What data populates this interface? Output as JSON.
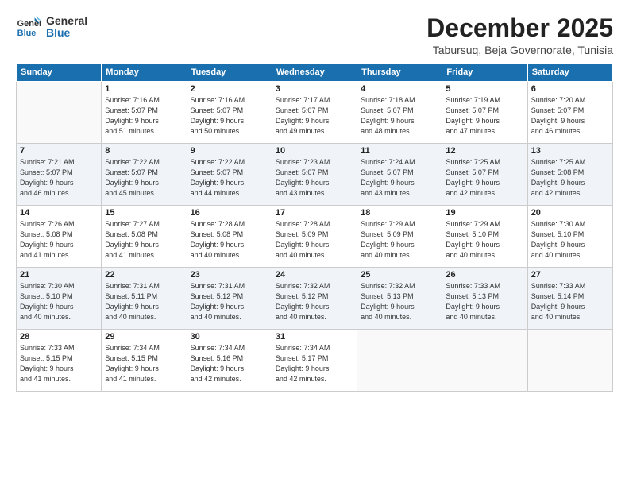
{
  "logo": {
    "line1": "General",
    "line2": "Blue"
  },
  "title": "December 2025",
  "subtitle": "Tabursuq, Beja Governorate, Tunisia",
  "days_of_week": [
    "Sunday",
    "Monday",
    "Tuesday",
    "Wednesday",
    "Thursday",
    "Friday",
    "Saturday"
  ],
  "weeks": [
    [
      {
        "num": "",
        "info": ""
      },
      {
        "num": "1",
        "info": "Sunrise: 7:16 AM\nSunset: 5:07 PM\nDaylight: 9 hours\nand 51 minutes."
      },
      {
        "num": "2",
        "info": "Sunrise: 7:16 AM\nSunset: 5:07 PM\nDaylight: 9 hours\nand 50 minutes."
      },
      {
        "num": "3",
        "info": "Sunrise: 7:17 AM\nSunset: 5:07 PM\nDaylight: 9 hours\nand 49 minutes."
      },
      {
        "num": "4",
        "info": "Sunrise: 7:18 AM\nSunset: 5:07 PM\nDaylight: 9 hours\nand 48 minutes."
      },
      {
        "num": "5",
        "info": "Sunrise: 7:19 AM\nSunset: 5:07 PM\nDaylight: 9 hours\nand 47 minutes."
      },
      {
        "num": "6",
        "info": "Sunrise: 7:20 AM\nSunset: 5:07 PM\nDaylight: 9 hours\nand 46 minutes."
      }
    ],
    [
      {
        "num": "7",
        "info": "Sunrise: 7:21 AM\nSunset: 5:07 PM\nDaylight: 9 hours\nand 46 minutes."
      },
      {
        "num": "8",
        "info": "Sunrise: 7:22 AM\nSunset: 5:07 PM\nDaylight: 9 hours\nand 45 minutes."
      },
      {
        "num": "9",
        "info": "Sunrise: 7:22 AM\nSunset: 5:07 PM\nDaylight: 9 hours\nand 44 minutes."
      },
      {
        "num": "10",
        "info": "Sunrise: 7:23 AM\nSunset: 5:07 PM\nDaylight: 9 hours\nand 43 minutes."
      },
      {
        "num": "11",
        "info": "Sunrise: 7:24 AM\nSunset: 5:07 PM\nDaylight: 9 hours\nand 43 minutes."
      },
      {
        "num": "12",
        "info": "Sunrise: 7:25 AM\nSunset: 5:07 PM\nDaylight: 9 hours\nand 42 minutes."
      },
      {
        "num": "13",
        "info": "Sunrise: 7:25 AM\nSunset: 5:08 PM\nDaylight: 9 hours\nand 42 minutes."
      }
    ],
    [
      {
        "num": "14",
        "info": "Sunrise: 7:26 AM\nSunset: 5:08 PM\nDaylight: 9 hours\nand 41 minutes."
      },
      {
        "num": "15",
        "info": "Sunrise: 7:27 AM\nSunset: 5:08 PM\nDaylight: 9 hours\nand 41 minutes."
      },
      {
        "num": "16",
        "info": "Sunrise: 7:28 AM\nSunset: 5:08 PM\nDaylight: 9 hours\nand 40 minutes."
      },
      {
        "num": "17",
        "info": "Sunrise: 7:28 AM\nSunset: 5:09 PM\nDaylight: 9 hours\nand 40 minutes."
      },
      {
        "num": "18",
        "info": "Sunrise: 7:29 AM\nSunset: 5:09 PM\nDaylight: 9 hours\nand 40 minutes."
      },
      {
        "num": "19",
        "info": "Sunrise: 7:29 AM\nSunset: 5:10 PM\nDaylight: 9 hours\nand 40 minutes."
      },
      {
        "num": "20",
        "info": "Sunrise: 7:30 AM\nSunset: 5:10 PM\nDaylight: 9 hours\nand 40 minutes."
      }
    ],
    [
      {
        "num": "21",
        "info": "Sunrise: 7:30 AM\nSunset: 5:10 PM\nDaylight: 9 hours\nand 40 minutes."
      },
      {
        "num": "22",
        "info": "Sunrise: 7:31 AM\nSunset: 5:11 PM\nDaylight: 9 hours\nand 40 minutes."
      },
      {
        "num": "23",
        "info": "Sunrise: 7:31 AM\nSunset: 5:12 PM\nDaylight: 9 hours\nand 40 minutes."
      },
      {
        "num": "24",
        "info": "Sunrise: 7:32 AM\nSunset: 5:12 PM\nDaylight: 9 hours\nand 40 minutes."
      },
      {
        "num": "25",
        "info": "Sunrise: 7:32 AM\nSunset: 5:13 PM\nDaylight: 9 hours\nand 40 minutes."
      },
      {
        "num": "26",
        "info": "Sunrise: 7:33 AM\nSunset: 5:13 PM\nDaylight: 9 hours\nand 40 minutes."
      },
      {
        "num": "27",
        "info": "Sunrise: 7:33 AM\nSunset: 5:14 PM\nDaylight: 9 hours\nand 40 minutes."
      }
    ],
    [
      {
        "num": "28",
        "info": "Sunrise: 7:33 AM\nSunset: 5:15 PM\nDaylight: 9 hours\nand 41 minutes."
      },
      {
        "num": "29",
        "info": "Sunrise: 7:34 AM\nSunset: 5:15 PM\nDaylight: 9 hours\nand 41 minutes."
      },
      {
        "num": "30",
        "info": "Sunrise: 7:34 AM\nSunset: 5:16 PM\nDaylight: 9 hours\nand 42 minutes."
      },
      {
        "num": "31",
        "info": "Sunrise: 7:34 AM\nSunset: 5:17 PM\nDaylight: 9 hours\nand 42 minutes."
      },
      {
        "num": "",
        "info": ""
      },
      {
        "num": "",
        "info": ""
      },
      {
        "num": "",
        "info": ""
      }
    ]
  ]
}
